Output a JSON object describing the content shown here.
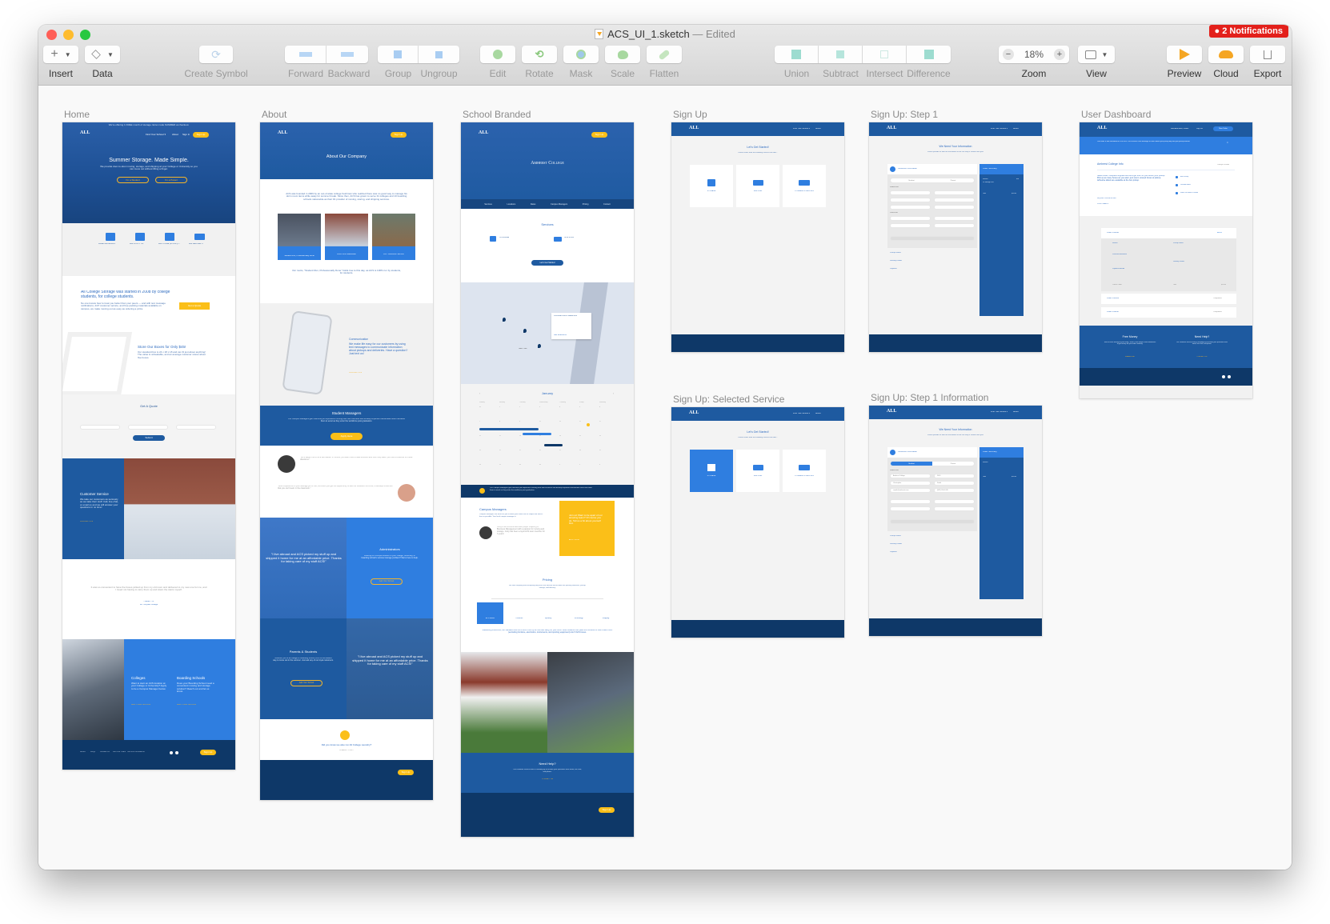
{
  "window": {
    "title": "ACS_UI_1.sketch",
    "title_status": "— Edited",
    "notifications_label": "2 Notifications",
    "traffic_lights": {
      "close": "#ff5f57",
      "minimize": "#febc2e",
      "zoom": "#28c840"
    }
  },
  "toolbar": {
    "insert": {
      "label": "Insert",
      "icon": "plus-icon"
    },
    "data": {
      "label": "Data",
      "icon": "layers-icon"
    },
    "create_symbol": {
      "label": "Create Symbol",
      "icon": "symbol-icon"
    },
    "forward": {
      "label": "Forward",
      "icon": "forward-icon"
    },
    "backward": {
      "label": "Backward",
      "icon": "backward-icon"
    },
    "group": {
      "label": "Group",
      "icon": "group-icon"
    },
    "ungroup": {
      "label": "Ungroup",
      "icon": "ungroup-icon"
    },
    "edit": {
      "label": "Edit",
      "icon": "edit-icon"
    },
    "rotate": {
      "label": "Rotate",
      "icon": "rotate-icon"
    },
    "mask": {
      "label": "Mask",
      "icon": "mask-icon"
    },
    "scale": {
      "label": "Scale",
      "icon": "scale-icon"
    },
    "flatten": {
      "label": "Flatten",
      "icon": "flatten-icon"
    },
    "union": {
      "label": "Union",
      "icon": "union-icon"
    },
    "subtract": {
      "label": "Subtract",
      "icon": "subtract-icon"
    },
    "intersect": {
      "label": "Intersect",
      "icon": "intersect-icon"
    },
    "difference": {
      "label": "Difference",
      "icon": "difference-icon"
    },
    "zoom": {
      "label": "Zoom",
      "value": "18%",
      "minus": "−",
      "plus": "+"
    },
    "view": {
      "label": "View",
      "icon": "layout-icon"
    },
    "preview": {
      "label": "Preview",
      "icon": "play-icon"
    },
    "cloud": {
      "label": "Cloud",
      "icon": "cloud-icon"
    },
    "export": {
      "label": "Export",
      "icon": "share-icon"
    }
  },
  "colors": {
    "brand_blue": "#1e5aa0",
    "bright_blue": "#2f7ee0",
    "navy": "#0e3868",
    "yellow": "#fbbf18"
  },
  "artboards": {
    "home": {
      "name": "Home",
      "banner": "We're offering 1 FREE month of storage. Enter code SUMMER at checkout.",
      "logo": "ALL",
      "nav": [
        "Find Your School ▾",
        "About",
        "Sign In"
      ],
      "signup": "Sign Up",
      "hero_title": "Summer Storage. Made Simple.",
      "hero_text": "We provide door-to-door moving, storage, and shipping at your College or University so you can move out without lifting a finger.",
      "hero_buttons": [
        "I'm a Student",
        "I'm a Parent"
      ],
      "steps": [
        {
          "title": "FREE MATERIALS",
          "text": "Grab free packing materials on campus."
        },
        {
          "title": "WE PICK IT UP",
          "text": "We pick your stuff up right from your doorstep."
        },
        {
          "title": "WE STORE (& SHIP) IT",
          "text": "We store your stuff over the summer."
        },
        {
          "title": "WE DELIVER IT",
          "text": "We deliver your boxes back to you in the fall."
        }
      ],
      "about_title": "All College Storage was started in 2008 by college students, for college students.",
      "about_text": "No one knows how to treat you better than your peers — and with text message notifications, 24/7 customer service, and free packing materials available on campus, we make moving out as easy as ordering a pizza.",
      "quote_btn": "Get a Quote",
      "boxes_title": "Store Our Boxes for Only $45!",
      "boxes_text": "Our standard box is 24 x 18 x 18 and can fit just about anything! The value is unbeatable, and an average customer stores about five boxes.",
      "quote_title": "Get A Quote",
      "quote_submit": "Submit",
      "cs_title": "Customer Service",
      "cs_text": "We take our customers as seriously as we take their stuff. Call, live-chat, or email us and we will answer your questions in no time!",
      "cs_link": "CONTACT US",
      "testimonial": "It was so convenient to have the boxes picked up from my old room and delivered to my new one for me, and I loved not having to carry them up and down the stairs myself.",
      "testimonial_author": "– Elida Y. B.",
      "testimonial_school": "Mt. Holyoke College",
      "colleges_title": "Colleges",
      "colleges_text": "Want to start an ACS location at your College or University? Apply to be a Campus Manager below.",
      "colleges_link": "ADD YOUR SCHOOL",
      "boarding_title": "Boarding Schools",
      "boarding_text": "Does your Boarding School need a convenient moving and storage solution? Reach out and let us know.",
      "boarding_link": "ADD YOUR SCHOOL",
      "footer": [
        "About",
        "FAQs",
        "Contact Us",
        "Join Our Team",
        "Terms & Conditions"
      ],
      "footer_signup": "Sign Up"
    },
    "about": {
      "name": "About",
      "hero_title": "About Our Company",
      "intro": "ACS was founded in 2009 by an out-of-state college freshman who realized there was no good way to manage his dorm room items while away for summer break. Since then, ACS has grown to serve 31 colleges and 10 boarding schools nationwide as their #1 provider of moving, storing, and shipping services.",
      "features": [
        "Student Run, Professionally Done",
        "Low Price Guarantee",
        "24/7 Customer Service"
      ],
      "motto": "Our motto, \"Student Run, Professionally Done\" holds true to this day, as ACS is 100% run by students, for students.",
      "comm_title": "Communication",
      "comm_text": "We make life easy for our customers by using text messages to communicate information about pickups and deliveries. Have a question? Just text us!",
      "comm_link": "CONTACT US",
      "managers_title": "Student Managers",
      "managers_text": "Our Campus Managers gain real-time job experience running their own business and develop important transferable skills that allow them to excel as they enter the workforce post graduation.",
      "managers_btn": "Apply Here",
      "quote1": "\"ACS taught me to be a self-starter. In school, you learn how to take direction and then they teach you how to execute on those directions.\"",
      "quote2": "\"Work experience in your average job is fine, but when you get the opportunity to see the business full circle, it develops a skill set that you can't learn in the classroom.\"",
      "testimonial": "\"I live abroad and ACS picked my stuff up and shipped it home for me at an affordable price. Thanks for taking care of my stuff ACS!\"",
      "admins_title": "Administrators",
      "admins_text": "Looking for a simple solution to your college, university, or boarding school's summer storage problem? We're here to help.",
      "admins_btn": "Add Your School",
      "parents_title": "Parents & Students",
      "parents_text": "Whether you're at college or boarding school, ACS is the easiest way to move out in the summer. Just ask any of our loyal customers.",
      "parents_btn": "Add Your School",
      "laundry": "Did you know we also run All College Laundry?",
      "laundry_link": "CHECK IT OUT"
    },
    "school_branded": {
      "name": "School Branded",
      "hero_title": "Amherst College",
      "subnav": [
        "Services",
        "Locations",
        "Dates",
        "Campus Managers",
        "Pricing",
        "Contact"
      ],
      "services_title": "Services",
      "services": [
        "STORAGE",
        "SHIPPING"
      ],
      "services_btn": "Let's Get Started",
      "map_popup_title": "Cromwell Dorm Basement",
      "map_popup_link": "Get Directions",
      "map_label": "New York",
      "calendar_month": "January",
      "calendar_days": [
        "Sunday",
        "Monday",
        "Tuesday",
        "Wednesday",
        "Thursday",
        "Friday",
        "Saturday"
      ],
      "calendar_weeks": [
        [
          "31",
          "1",
          "2",
          "3",
          "4",
          "5",
          "6"
        ],
        [
          "7",
          "8",
          "9",
          "10",
          "11",
          "12",
          "13"
        ],
        [
          "14",
          "15",
          "16",
          "17",
          "18",
          "19",
          "20"
        ],
        [
          "21",
          "22",
          "23",
          "24",
          "25",
          "26",
          "27"
        ],
        [
          "28",
          "29",
          "30",
          "31",
          "1",
          "2",
          "3"
        ]
      ],
      "managers_strip": "Our Campus Managers gain real-time job experience running their own business and develop important transferable skills that allow them to excel as they enter the workforce post graduation.",
      "campus_title": "Campus Managers",
      "campus_text": "Campus Managers are there for you to make your move-out as simple and stress-free as possible. Your local campus manager is",
      "campus_bio": "Cody is an Amherst lacrosse player majoring in Business Management with a passion for moving and storage. Cody has been a loyal ACS team member for 3 years!",
      "join_text": "Join us! Want to be apart of our amazing team? Of course you do. Tell us a bit about yourself first.",
      "join_link": "APPLY NOW",
      "pricing_title": "Pricing",
      "pricing_text": "We store anything and everything! All prices are flat-free and include free packing materials, pickup, storage, and delivery.",
      "pricing_tabs": [
        "ACS Boxes",
        "Furniture",
        "Sporting",
        "Technology",
        "Shipping"
      ],
      "pricing_desc": "Measuring 24x18x18, our standard size ACS box is the by far the best bang for your buck. Most students can pack the contents of their entire room (excluding furniture, electronics, instruments, and sporting equipment) into 5 ACS boxes.",
      "help_title": "Need Help?",
      "help_text": "Our customer service team is standing by to answer your questions over email, live chat, and phone.",
      "help_link": "CONTACT US"
    },
    "signup": {
      "name": "Sign Up",
      "title": "Let's Get Started!",
      "subtitle": "Please select from the following services we offer...",
      "nav": [
        "Find Your School ▾",
        "About"
      ],
      "services": [
        "STORAGE",
        "SHIPPING",
        "STORAGE & SHIPPING"
      ]
    },
    "signup_selected": {
      "name": "Sign Up: Selected Service",
      "selected_index": 0
    },
    "signup_step1": {
      "name": "Sign Up: Step 1",
      "title": "We Need Your Information",
      "subtitle": "Please provide us with the info below so we can stay in contact with you!",
      "section": "Customer Information",
      "toggle": [
        "Student",
        "Parent"
      ],
      "student_info": "Student Info",
      "fields": [
        "School Name",
        "Class Year",
        "Student First Name",
        "Student Last Name",
        "Student Email",
        "Student Contact Number"
      ],
      "parent_info": "Parent Info",
      "steps": [
        "Pickup Details",
        "Delivery Details",
        "Payment"
      ],
      "summary_title": "Order Summary",
      "summary_service": "Service",
      "summary_service_detail": "1x Storage Fee",
      "summary_edit": "Edit",
      "summary_total": "Total",
      "summary_total_value": "$00.00"
    },
    "signup_step1_info": {
      "name": "Sign Up: Step 1 Information",
      "fields": [
        "Amherst College",
        "2019",
        "Christopher",
        "Smith",
        "csmith@amherst.com",
        "(987) 555-1245"
      ]
    },
    "dashboard": {
      "name": "User Dashboard",
      "nav_welcome": "Welcome back, Parker!",
      "nav_logout": "Log Out",
      "nav_new_order": "New Order",
      "alert": "Your order is now confirmed for 5/14/2019! You'll receive a text message 48 hours before your pickup day with your pickup timeslot.",
      "info_title": "Amherst College Info",
      "info_change": "Change Location",
      "info_text": "Need boxes? Request supplies and we'll get them to you before your pickup! Pick up as many boxes as you want, just return unused boxes at pickup. Adhesive labels are available at the box pickup.",
      "info_links": [
        "REQUEST MORE BOXES",
        "PRINT LABELS"
      ],
      "info_items": [
        "Box Pickup",
        "Location Hours",
        "What You Need To Know"
      ],
      "orders": [
        {
          "id": "Order #10894",
          "status": "Active"
        },
        {
          "id": "Order #11029",
          "status": "Completed"
        },
        {
          "id": "Order #10293",
          "status": "Completed"
        }
      ],
      "order_details": {
        "service": "Service",
        "service_detail": "1x Storage Fee",
        "personal": "Personal Information",
        "personal_detail": "Amherst College, Class of 2019",
        "payment": "Payment Method",
        "payment_detail": "Mastercard ****1234",
        "pickup": "Pickup Details",
        "pickup_detail": "Brookton Dormitory, May 20, 2019",
        "delivery": "Delivery Details",
        "delivery_detail": "Brookton Dormitory, May 20, 2019",
        "cancel": "Cancel Order",
        "total": "Total",
        "total_value": "$00.00",
        "edit": "Edit"
      },
      "free_money_title": "Free Money",
      "free_money_text": "Want to save money off your order? Enter a few friends' email addresses to get money off your order instantly.",
      "free_money_link": "SHARE LINK",
      "help_title": "Need Help?",
      "help_text": "Our customer service team is standing by to answer your questions over email, live chat, and phone.",
      "help_link": "CONTACT US"
    }
  }
}
